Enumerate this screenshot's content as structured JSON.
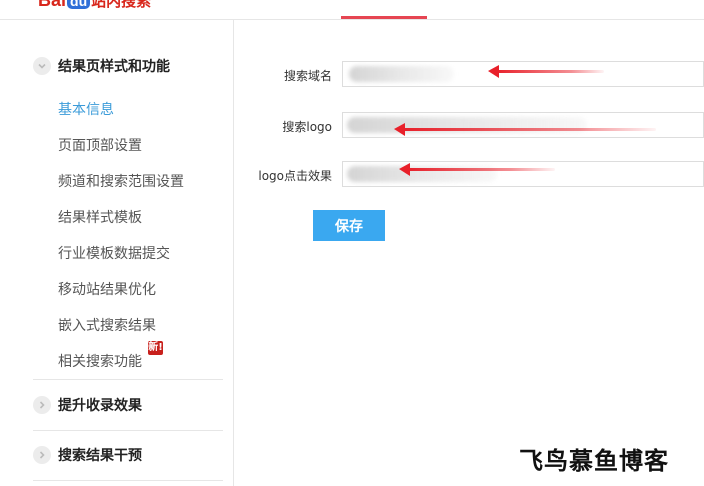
{
  "header": {
    "logo_text": "Bai",
    "logo_paw": "du",
    "logo_cn": "站内搜索"
  },
  "sidebar": {
    "sections": [
      {
        "title": "结果页样式和功能",
        "expanded": true,
        "items": [
          {
            "label": "基本信息",
            "active": true
          },
          {
            "label": "页面顶部设置"
          },
          {
            "label": "频道和搜索范围设置"
          },
          {
            "label": "结果样式模板"
          },
          {
            "label": "行业模板数据提交"
          },
          {
            "label": "移动站结果优化"
          },
          {
            "label": "嵌入式搜索结果"
          },
          {
            "label": "相关搜索功能",
            "badge": "新!"
          }
        ]
      },
      {
        "title": "提升收录效果",
        "expanded": false
      },
      {
        "title": "搜索结果干预",
        "expanded": false
      }
    ]
  },
  "form": {
    "fields": [
      {
        "label": "搜索域名",
        "value": ""
      },
      {
        "label": "搜索logo",
        "value": ""
      },
      {
        "label": "logo点击效果",
        "value": ""
      }
    ],
    "save_label": "保存"
  },
  "watermark": "飞鸟慕鱼博客",
  "colors": {
    "accent": "#3aa8f0",
    "active_link": "#3a9bd9",
    "nav_indicator": "#e64552",
    "arrow": "#e8202a",
    "badge": "#c8201c"
  }
}
